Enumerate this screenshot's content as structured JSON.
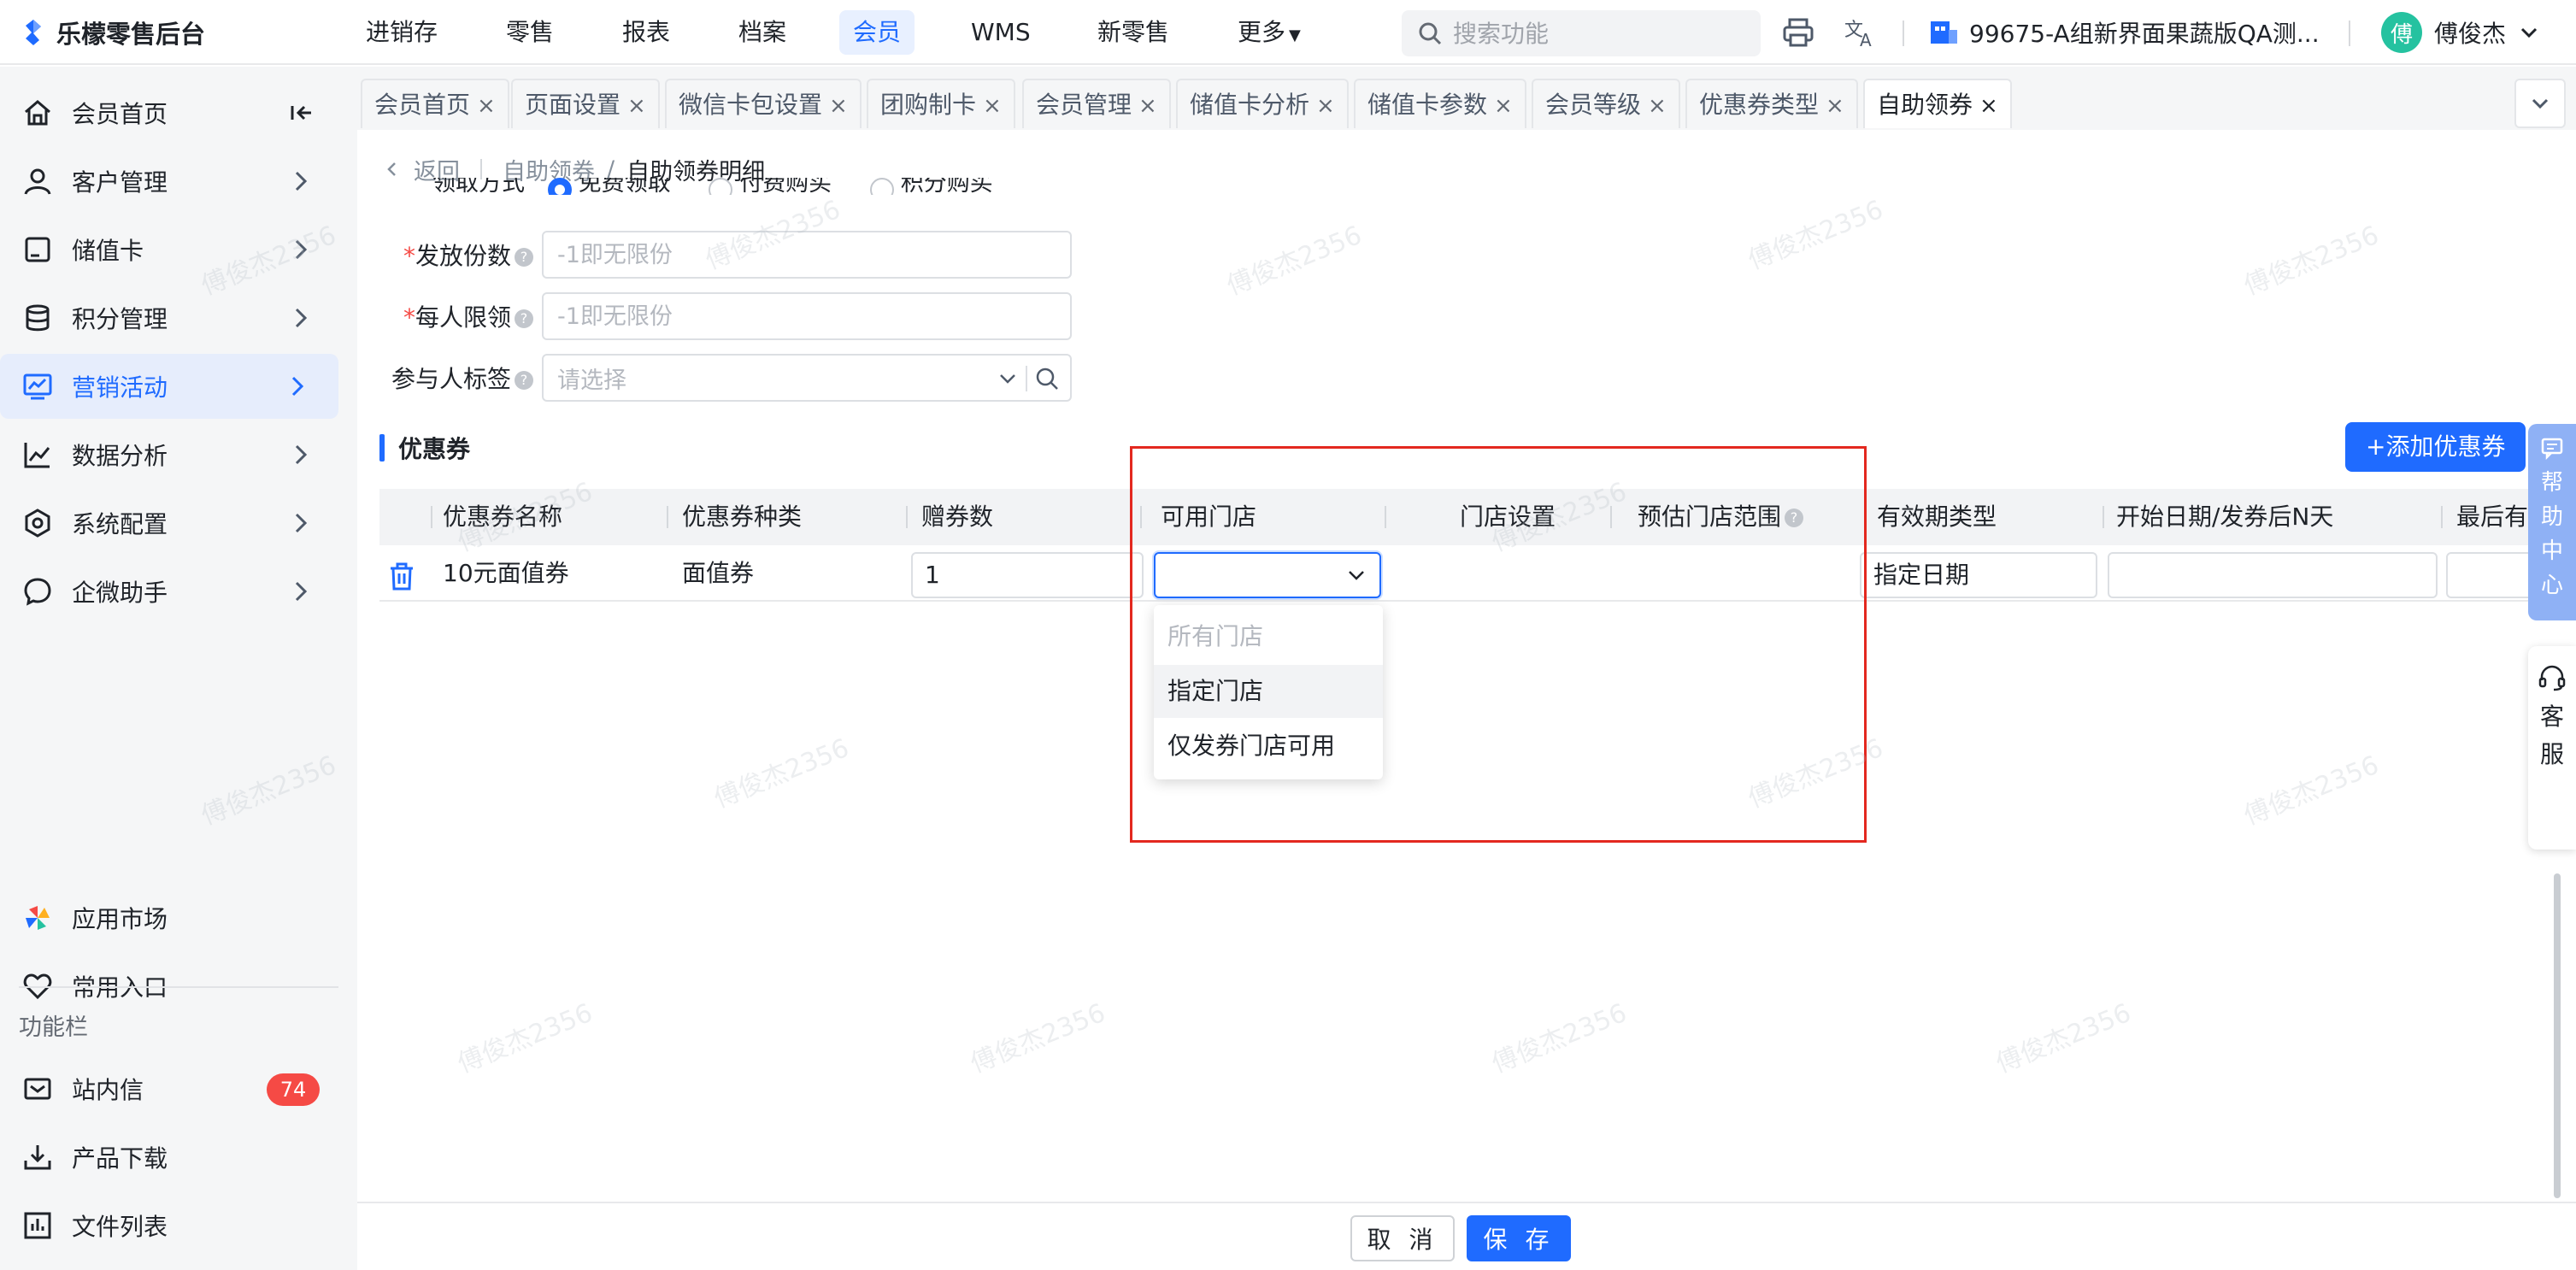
{
  "app": {
    "title": "乐檬零售后台"
  },
  "topnav": [
    "进销存",
    "零售",
    "报表",
    "档案",
    "会员",
    "WMS",
    "新零售",
    "更多"
  ],
  "topnav_active": "会员",
  "search": {
    "placeholder": "搜索功能"
  },
  "store": {
    "name": "99675-A组新界面果蔬版QA测..."
  },
  "user": {
    "name": "傅俊杰",
    "avatar": "傅"
  },
  "sidebar": {
    "items": [
      "会员首页",
      "客户管理",
      "储值卡",
      "积分管理",
      "营销活动",
      "数据分析",
      "系统配置",
      "企微助手"
    ],
    "active": "营销活动",
    "bottom": [
      "应用市场",
      "常用入口"
    ],
    "section_label": "功能栏",
    "tools": [
      "站内信",
      "产品下载",
      "文件列表"
    ],
    "inbox_badge": "74"
  },
  "tabs": [
    "会员首页",
    "页面设置",
    "微信卡包设置",
    "团购制卡",
    "会员管理",
    "储值卡分析",
    "储值卡参数",
    "会员等级",
    "优惠券类型",
    "自助领券"
  ],
  "tab_close": "×",
  "active_tab": "自助领券",
  "breadcrumb": {
    "back": "返回",
    "parent": "自助领券",
    "sep": "/",
    "current": "自助领券明细"
  },
  "form": {
    "partial_row": {
      "label": "领取方式",
      "options": [
        "免费领取",
        "付费购买",
        "积分购买"
      ]
    },
    "issue_count": {
      "label": "发放份数",
      "placeholder": "-1即无限份"
    },
    "per_limit": {
      "label": "每人限领",
      "placeholder": "-1即无限份"
    },
    "tags": {
      "label": "参与人标签",
      "placeholder": "请选择"
    }
  },
  "coupon_section": {
    "title": "优惠券",
    "add_button": "+添加优惠券",
    "columns": [
      "优惠券名称",
      "优惠券种类",
      "赠券数",
      "可用门店",
      "门店设置",
      "预估门店范围",
      "有效期类型",
      "开始日期/发券后N天",
      "最后有"
    ],
    "row": {
      "name": "10元面值券",
      "type": "面值券",
      "count": "1",
      "store": "",
      "validity_type": "指定日期"
    }
  },
  "dropdown": {
    "options": [
      "所有门店",
      "指定门店",
      "仅发券门店可用"
    ],
    "disabled": "所有门店",
    "hover": "指定门店"
  },
  "footer": {
    "cancel": "取 消",
    "save": "保 存"
  },
  "help_center": [
    "帮",
    "助",
    "中",
    "心"
  ],
  "customer_service": [
    "客",
    "服"
  ],
  "watermark": "傅俊杰2356",
  "colors": {
    "primary": "#1f6bff",
    "danger": "#f54a45",
    "highlight_box": "#e3281f"
  }
}
